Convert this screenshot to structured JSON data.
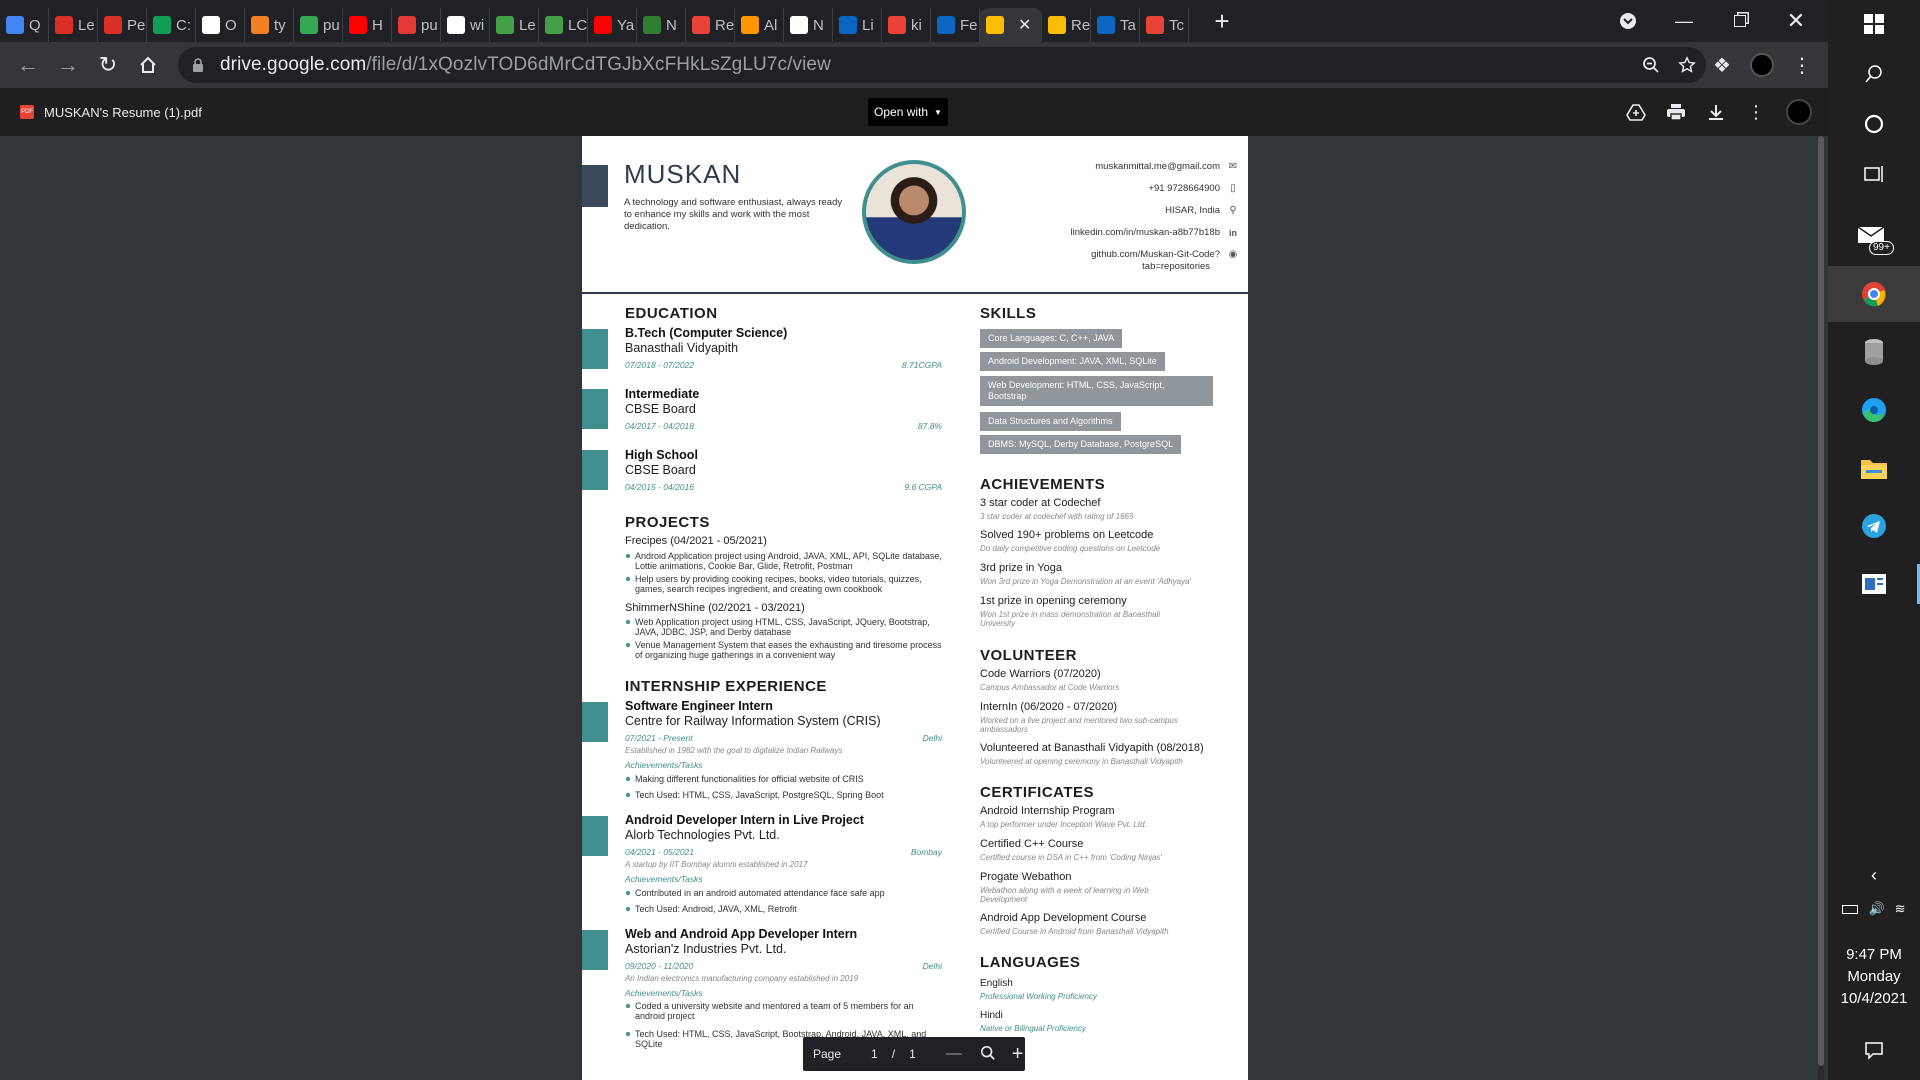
{
  "browser": {
    "tabs": [
      {
        "label": "Q",
        "icon": "chrome-swirl-icon",
        "color": "#4285f4"
      },
      {
        "label": "Le",
        "icon": "youtube-lab-icon",
        "color": "#d93025"
      },
      {
        "label": "Pe",
        "icon": "youtube-lab-icon",
        "color": "#d93025"
      },
      {
        "label": "C:",
        "icon": "w-logo-icon",
        "color": "#0f9d58"
      },
      {
        "label": "O",
        "icon": "cap-icon",
        "color": "#ffffff"
      },
      {
        "label": "ty",
        "icon": "stack-icon",
        "color": "#f48024"
      },
      {
        "label": "pu",
        "icon": "sparkle-icon",
        "color": "#34a853"
      },
      {
        "label": "H",
        "icon": "youtube-icon",
        "color": "#ff0000"
      },
      {
        "label": "pu",
        "icon": "n-logo-icon",
        "color": "#e53935"
      },
      {
        "label": "wi",
        "icon": "google-icon",
        "color": "#ffffff"
      },
      {
        "label": "Le",
        "icon": "bracket-icon",
        "color": "#43a047"
      },
      {
        "label": "LC",
        "icon": "bracket-icon",
        "color": "#43a047"
      },
      {
        "label": "Ya",
        "icon": "youtube-icon",
        "color": "#ff0000"
      },
      {
        "label": "N",
        "icon": "infinity-icon",
        "color": "#2e7d32"
      },
      {
        "label": "Re",
        "icon": "gmail-icon",
        "color": "#ea4335"
      },
      {
        "label": "Al",
        "icon": "warning-icon",
        "color": "#ff9800"
      },
      {
        "label": "N",
        "icon": "openai-icon",
        "color": "#ffffff"
      },
      {
        "label": "Li",
        "icon": "linkedin-icon",
        "color": "#0a66c2"
      },
      {
        "label": "ki",
        "icon": "gmail-icon",
        "color": "#ea4335"
      },
      {
        "label": "Fe",
        "icon": "linkedin-icon",
        "color": "#0a66c2"
      },
      {
        "label": "",
        "icon": "drive-icon",
        "color": "#fbbc04",
        "active": true
      },
      {
        "label": "Re",
        "icon": "drive-icon",
        "color": "#fbbc04"
      },
      {
        "label": "Ta",
        "icon": "linkedin-icon",
        "color": "#0a66c2"
      },
      {
        "label": "Tc",
        "icon": "gmail-icon",
        "color": "#ea4335"
      }
    ],
    "url_host": "drive.google.com",
    "url_path": "/file/d/1xQozlvTOD6dMrCdTGJbXcFHkLsZgLU7c/view"
  },
  "viewer": {
    "file_name": "MUSKAN's Resume (1).pdf",
    "open_with": "Open with",
    "page_label": "Page",
    "page_current": "1",
    "page_sep": "/",
    "page_total": "1"
  },
  "resume": {
    "name": "MUSKAN",
    "tagline": "A technology and software enthusiast, always ready to enhance my skills and work with the most dedication.",
    "contact": {
      "email": "muskanmittal.me@gmail.com",
      "phone": "+91 9728664900",
      "location": "HISAR, India",
      "linkedin": "linkedin.com/in/muskan-a8b77b18b",
      "github_1": "github.com/Muskan-Git-Code?",
      "github_2": "tab=repositories"
    },
    "education": {
      "heading": "EDUCATION",
      "items": [
        {
          "title": "B.Tech (Computer Science)",
          "school": "Banasthali Vidyapith",
          "dates": "07/2018 - 07/2022",
          "grade": "8.71CGPA"
        },
        {
          "title": "Intermediate",
          "school": "CBSE Board",
          "dates": "04/2017 - 04/2018",
          "grade": "87.8%"
        },
        {
          "title": "High School",
          "school": "CBSE Board",
          "dates": "04/2015 - 04/2016",
          "grade": "9.6 CGPA"
        }
      ]
    },
    "projects": {
      "heading": "PROJECTS",
      "items": [
        {
          "title": "Frecipes (04/2021 - 05/2021)",
          "b1": "Android Application project using Android, JAVA, XML, API, SQLite database, Lottie animations, Cookie Bar, Glide, Retrofit, Postman",
          "b2": "Help users by providing cooking recipes, books, video tutorials, quizzes, games, search recipes ingredient, and creating own cookbook"
        },
        {
          "title": "ShimmerNShine (02/2021 - 03/2021)",
          "b1": "Web Application project using HTML, CSS, JavaScript, JQuery, Bootstrap, JAVA, JDBC, JSP, and Derby database",
          "b2": "Venue Management System that eases the exhausting and tiresome process of organizing huge gatherings in a convenient way"
        }
      ]
    },
    "internship": {
      "heading": "INTERNSHIP EXPERIENCE",
      "tasks_label": "Achievements/Tasks",
      "items": [
        {
          "title": "Software Engineer Intern",
          "company": "Centre for Railway Information System (CRIS)",
          "dates": "07/2021 - Present",
          "place": "Delhi",
          "note": "Established in 1982 with the goal to digitalize Indian Railways",
          "b1": "Making different functionalities for official website of CRIS",
          "b2": "Tech Used: HTML, CSS, JavaScript, PostgreSQL, Spring Boot"
        },
        {
          "title": "Android Developer Intern in Live Project",
          "company": "Alorb Technologies Pvt. Ltd.",
          "dates": "04/2021 - 05/2021",
          "place": "Bombay",
          "note": "A startup by IIT Bombay alumni established in 2017",
          "b1": "Contributed in an android automated attendance face safe app",
          "b2": "Tech Used: Android, JAVA, XML, Retrofit"
        },
        {
          "title": "Web and Android App Developer Intern",
          "company": "Astorian'z Industries Pvt. Ltd.",
          "dates": "09/2020 - 11/2020",
          "place": "Delhi",
          "note": "An Indian electronics manufacturing company established in 2019",
          "b1": "Coded a university website and mentored a team of 5 members for an android project",
          "b2": "Tech Used: HTML, CSS, JavaScript, Bootstrap, Android, JAVA, XML, and SQLite"
        }
      ]
    },
    "skills": {
      "heading": "SKILLS",
      "chips": [
        "Core Languages: C, C++, JAVA",
        "Android Development: JAVA, XML, SQLite",
        "Web Development: HTML, CSS, JavaScript, Bootstrap",
        "Data Structures and Algorithms",
        "DBMS: MySQL, Derby Database, PostgreSQL"
      ]
    },
    "achievements": {
      "heading": "ACHIEVEMENTS",
      "items": [
        {
          "title": "3 star coder at Codechef",
          "note": "3 star coder at codechef with rating of 1669"
        },
        {
          "title": "Solved 190+ problems on Leetcode",
          "note": "Do daily competitive coding questions on Leetcode"
        },
        {
          "title": "3rd prize in Yoga",
          "note": "Won 3rd prize in Yoga Demonstration at an event 'Adhyaya'"
        },
        {
          "title": "1st prize in opening ceremony",
          "note": "Won 1st prize in mass demonstration at Banasthali University"
        }
      ]
    },
    "volunteer": {
      "heading": "VOLUNTEER",
      "items": [
        {
          "title": "Code Warriors (07/2020)",
          "note": "Campus Ambassador at Code Warriors"
        },
        {
          "title": "InternIn (06/2020 - 07/2020)",
          "note": "Worked on a live project and mentored two sub-campus ambassadors"
        },
        {
          "title": "Volunteered at Banasthali Vidyapith (08/2018)",
          "note": "Volunteered at opening ceremony in Banasthali Vidyapith"
        }
      ]
    },
    "certificates": {
      "heading": "CERTIFICATES",
      "items": [
        {
          "title": "Android Internship Program",
          "note": "A top performer under Inception Wave Pvt. Ltd."
        },
        {
          "title": "Certified C++ Course",
          "note": "Certified course in DSA in C++ from 'Coding Ninjas'"
        },
        {
          "title": "Progate Webathon",
          "note": "Webathon along with a week of learning in Web Development"
        },
        {
          "title": "Android App Development Course",
          "note": "Certified Course in Android from Banasthali Vidyapith"
        }
      ]
    },
    "languages": {
      "heading": "LANGUAGES",
      "items": [
        {
          "title": "English",
          "note": "Professional Working Proficiency"
        },
        {
          "title": "Hindi",
          "note": "Native or Bilingual Proficiency"
        }
      ]
    }
  },
  "taskbar": {
    "notif_badge": "99+",
    "time": "9:47 PM",
    "day": "Monday",
    "date": "10/4/2021"
  }
}
